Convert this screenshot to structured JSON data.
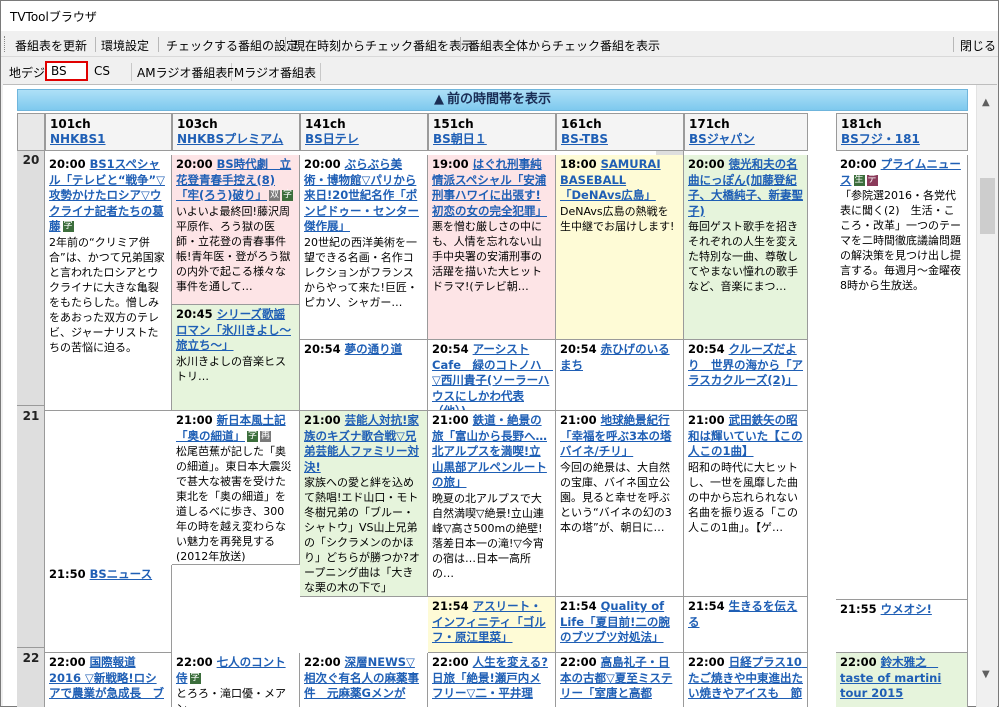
{
  "window": {
    "title": "TVToolブラウザ"
  },
  "toolbar": {
    "items": [
      "番組表を更新",
      "環境設定",
      "チェックする番組の設定",
      "現在時刻からチェック番組を表示",
      "番組表全体からチェック番組を表示"
    ],
    "close": "閉じる"
  },
  "tabs": [
    {
      "label": "地デジ",
      "selected": false
    },
    {
      "label": "BS",
      "selected": true
    },
    {
      "label": "CS",
      "selected": false
    },
    {
      "label": "AMラジオ番組表",
      "selected": false
    },
    {
      "label": "FMラジオ番組表",
      "selected": false
    }
  ],
  "prev_button": "前の時間帯を表示",
  "channels": [
    {
      "num": "101ch",
      "name": "NHKBS1"
    },
    {
      "num": "103ch",
      "name": "NHKBSプレミアム"
    },
    {
      "num": "141ch",
      "name": "BS日テレ"
    },
    {
      "num": "151ch",
      "name": "BS朝日１"
    },
    {
      "num": "161ch",
      "name": "BS-TBS"
    },
    {
      "num": "171ch",
      "name": "BSジャパン"
    },
    {
      "num": "181ch",
      "name": "BSフジ・181"
    }
  ],
  "hours": [
    "20",
    "21",
    "22"
  ],
  "programs": [
    {
      "id": "p1",
      "ch": 0,
      "time": "20:00",
      "title": "BS1スペシャル「テレビと“戦争”▽攻勢かけたロシア▽ウクライナ記者たちの葛藤",
      "badges": [
        "字"
      ],
      "desc": "2年前の“クリミア併合”は、かつて兄弟国家と言われたロシアとウクライナに大きな亀裂をもたらした。憎しみをあおった双方のテレビ、ジャーナリストたちの苦悩に迫る。",
      "color": "white"
    },
    {
      "id": "p2",
      "ch": 0,
      "time": "21:50",
      "title": "BSニュース",
      "badges": [],
      "desc": "",
      "color": "white"
    },
    {
      "id": "p3",
      "ch": 0,
      "time": "22:00",
      "title": "国際報道2016 ▽新戦略!ロシアで農業が急成長　ブー",
      "badges": [],
      "desc": "",
      "color": "white"
    },
    {
      "id": "p4",
      "ch": 1,
      "time": "20:00",
      "title": "BS時代劇　立花登青春手控え(8)「牢(ろう)破り」",
      "badges": [
        "双",
        "字"
      ],
      "desc": "いよいよ最終回!藤沢周平原作、ろう獄の医師・立花登の青春事件帳!青年医・登がろう獄の内外で起こる様々な事件を通して…",
      "color": "pink"
    },
    {
      "id": "p5",
      "ch": 1,
      "time": "20:45",
      "title": "シリーズ歌謡ロマン「氷川きよし～旅立ち～」",
      "badges": [],
      "desc": "氷川きよしの音楽ヒストリ…",
      "color": "green"
    },
    {
      "id": "p6",
      "ch": 1,
      "time": "21:00",
      "title": "新日本風土記「奥の細道」",
      "badges": [
        "字",
        "再"
      ],
      "desc": "松尾芭蕉が記した「奥の細道」。東日本大震災で甚大な被害を受けた東北を「奥の細道」を道しるべに歩き、300年の時を越え変わらない魅力を再発見する(2012年放送)",
      "color": "white"
    },
    {
      "id": "p7",
      "ch": 1,
      "time": "22:00",
      "title": "七人のコント侍",
      "badges": [
        "字"
      ],
      "desc": "とろろ・滝口優・メアン…",
      "color": "white"
    },
    {
      "id": "p8",
      "ch": 2,
      "time": "20:00",
      "title": "ぶらぶら美術・博物館▽パリから来日!20世紀名作「ポンピドゥー・センター傑作展」",
      "badges": [],
      "desc": "20世紀の西洋美術を一望できる名画・名作コレクションがフランスからやって来た!巨匠・ピカソ、シャガー…",
      "color": "white"
    },
    {
      "id": "p9",
      "ch": 2,
      "time": "20:54",
      "title": "夢の通り道",
      "badges": [],
      "desc": "",
      "color": "white"
    },
    {
      "id": "p10",
      "ch": 2,
      "time": "21:00",
      "title": "芸能人対抗!家族のキズナ歌合戦▽兄弟芸能人ファミリー対決!",
      "badges": [],
      "desc": "家族への愛と絆を込めて熱唱!エド山口・モト冬樹兄弟の「ブルー・シャトウ」VS山上兄弟の「シクラメンのかほり」どちらが勝つか?オープニング曲は「大きな栗の木の下で」",
      "color": "green"
    },
    {
      "id": "p11",
      "ch": 2,
      "time": "22:00",
      "title": "深層NEWS▽相次ぐ有名人の麻薬事件　元麻薬Gメンが",
      "badges": [],
      "desc": "",
      "color": "white"
    },
    {
      "id": "p12",
      "ch": 3,
      "time": "19:00",
      "title": "はぐれ刑事純情派スペシャル「安浦刑事ハワイに出張す!初恋の女の完全犯罪」",
      "badges": [],
      "desc": "悪を憎む厳しさの中にも、人情を忘れない山手中央署の安浦刑事の活躍を描いた大ヒットドラマ!(テレビ朝…",
      "color": "pink"
    },
    {
      "id": "p13",
      "ch": 3,
      "time": "20:54",
      "title": "アーシストCafe　緑のコトノハ　▽西川貴子(ソーラーハウスにしかわ代表（他）)",
      "badges": [],
      "desc": "",
      "color": "white"
    },
    {
      "id": "p14",
      "ch": 3,
      "time": "21:00",
      "title": "鉄道・絶景の旅「富山から長野へ…北アルプスを満喫!立山黒部アルペンルートの旅」",
      "badges": [],
      "desc": "晩夏の北アルプスで大自然満喫▽絶景!立山連峰▽高さ500mの絶壁!落差日本一の滝!▽今宵の宿は…日本一高所の…",
      "color": "white"
    },
    {
      "id": "p15",
      "ch": 3,
      "time": "21:54",
      "title": "アスリート・インフィニティ「ゴルフ・原江里菜」",
      "badges": [],
      "desc": "",
      "color": "yellow"
    },
    {
      "id": "p16",
      "ch": 3,
      "time": "22:00",
      "title": "人生を変える?日旅「絶景!瀬戸内メフリー▽二・平井理",
      "badges": [],
      "desc": "",
      "color": "white"
    },
    {
      "id": "p17",
      "ch": 4,
      "time": "18:00",
      "title": "SAMURAI BASEBALL「DeNAvs広島」",
      "badges": [],
      "desc": "DeNAvs広島の熱戦を生中継でお届けします!",
      "color": "yellow"
    },
    {
      "id": "p18",
      "ch": 4,
      "time": "20:54",
      "title": "赤ひげのいるまち",
      "badges": [],
      "desc": "",
      "color": "white"
    },
    {
      "id": "p19",
      "ch": 4,
      "time": "21:00",
      "title": "地球絶景紀行「幸福を呼ぶ3本の塔 バイネ/チリ」",
      "badges": [],
      "desc": "今回の絶景は、大自然の宝庫、バイネ国立公園。見ると幸せを呼ぶという“バイネの幻の3本の塔”が、朝日に…",
      "color": "white"
    },
    {
      "id": "p20",
      "ch": 4,
      "time": "21:54",
      "title": "Quality of Life「夏目前!二の腕のブツブツ対処法」",
      "badges": [],
      "desc": "",
      "color": "white"
    },
    {
      "id": "p21",
      "ch": 4,
      "time": "22:00",
      "title": "高島礼子・日本の古都▽夏至ミステリー「室唐と高都",
      "badges": [],
      "desc": "",
      "color": "white"
    },
    {
      "id": "p22",
      "ch": 5,
      "time": "20:00",
      "title": "徳光和夫の名曲にっぽん(加藤登紀子、大橋純子、新妻聖子)",
      "badges": [],
      "desc": "毎回ゲスト歌手を招きそれぞれの人生を変えた特別な一曲、尊敬してやまない憧れの歌手など、音楽にまつ…",
      "color": "green"
    },
    {
      "id": "p23",
      "ch": 5,
      "time": "20:54",
      "title": "クルーズだより　世界の海から「アラスカクルーズ(2)」",
      "badges": [],
      "desc": "",
      "color": "white"
    },
    {
      "id": "p24",
      "ch": 5,
      "time": "21:00",
      "title": "武田鉄矢の昭和は輝いていた【この人この1曲】",
      "badges": [],
      "desc": "昭和の時代に大ヒットし、一世を風靡した曲の中から忘れられない名曲を振り返る「この人この1曲」。【ゲ…",
      "color": "white"
    },
    {
      "id": "p25",
      "ch": 5,
      "time": "21:54",
      "title": "生きるを伝える",
      "badges": [],
      "desc": "",
      "color": "white"
    },
    {
      "id": "p26",
      "ch": 5,
      "time": "22:00",
      "title": "日経プラス10　たご焼きや中東進出たい焼きやアイスも　節",
      "badges": [],
      "desc": "",
      "color": "white"
    },
    {
      "id": "p27",
      "ch": 6,
      "time": "20:00",
      "title": "プライムニュース",
      "badges": [
        "生",
        "デ"
      ],
      "desc": "「参院選2016・各党代表に聞く(2)　生活・こころ・改革」一つのテーマを二時間徹底議論問題の解決策を見つけ出し提言する。毎週月～金曜夜8時から生放送。",
      "color": "white"
    },
    {
      "id": "p28",
      "ch": 6,
      "time": "21:55",
      "title": "ウメオシ!",
      "badges": [],
      "desc": "",
      "color": "white"
    },
    {
      "id": "p29",
      "ch": 6,
      "time": "22:00",
      "title": "鈴木雅之　taste of martini tour 2015",
      "badges": [],
      "desc": "",
      "color": "green"
    }
  ]
}
